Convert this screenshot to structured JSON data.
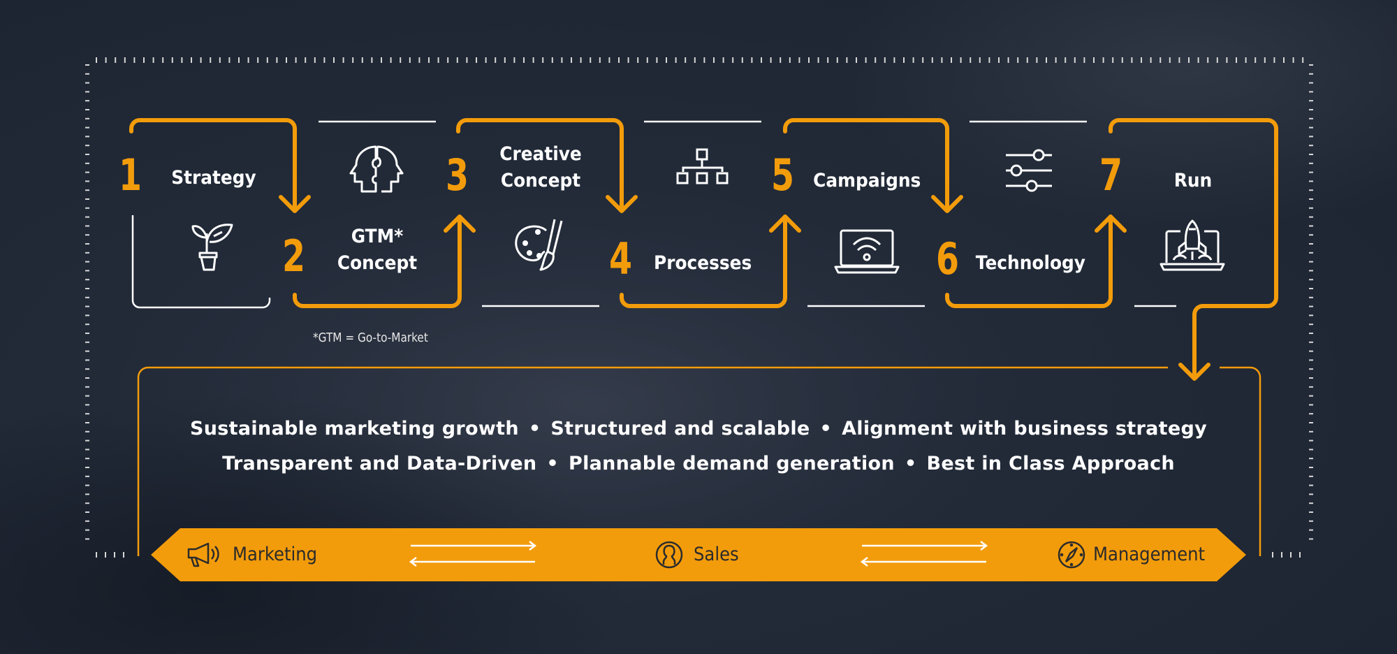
{
  "colors": {
    "accent": "#f39c0b",
    "background": "#222a38",
    "text": "#ffffff",
    "band_text": "#2b2b2b"
  },
  "steps": [
    {
      "number": "1",
      "label": "Strategy",
      "icon": "plant-pot-icon"
    },
    {
      "number": "2",
      "label_line1": "GTM*",
      "label_line2": "Concept",
      "icon": "puzzle-heads-icon"
    },
    {
      "number": "3",
      "label_line1": "Creative",
      "label_line2": "Concept",
      "icon": "palette-brush-icon"
    },
    {
      "number": "4",
      "label": "Processes",
      "icon": "org-chart-icon"
    },
    {
      "number": "5",
      "label": "Campaigns",
      "icon": "laptop-wifi-icon"
    },
    {
      "number": "6",
      "label": "Technology",
      "icon": "sliders-icon"
    },
    {
      "number": "7",
      "label": "Run",
      "icon": "rocket-laptop-icon"
    }
  ],
  "footnote": "*GTM = Go-to-Market",
  "benefits": {
    "row1": [
      "Sustainable marketing growth",
      "Structured and scalable",
      "Alignment with business strategy"
    ],
    "row2": [
      "Transparent and Data-Driven",
      "Plannable demand generation",
      "Best in Class Approach"
    ],
    "separator": "•"
  },
  "band": {
    "items": [
      {
        "label": "Marketing",
        "icon": "megaphone-icon"
      },
      {
        "label": "Sales",
        "icon": "person-icon"
      },
      {
        "label": "Management",
        "icon": "compass-icon"
      }
    ]
  }
}
